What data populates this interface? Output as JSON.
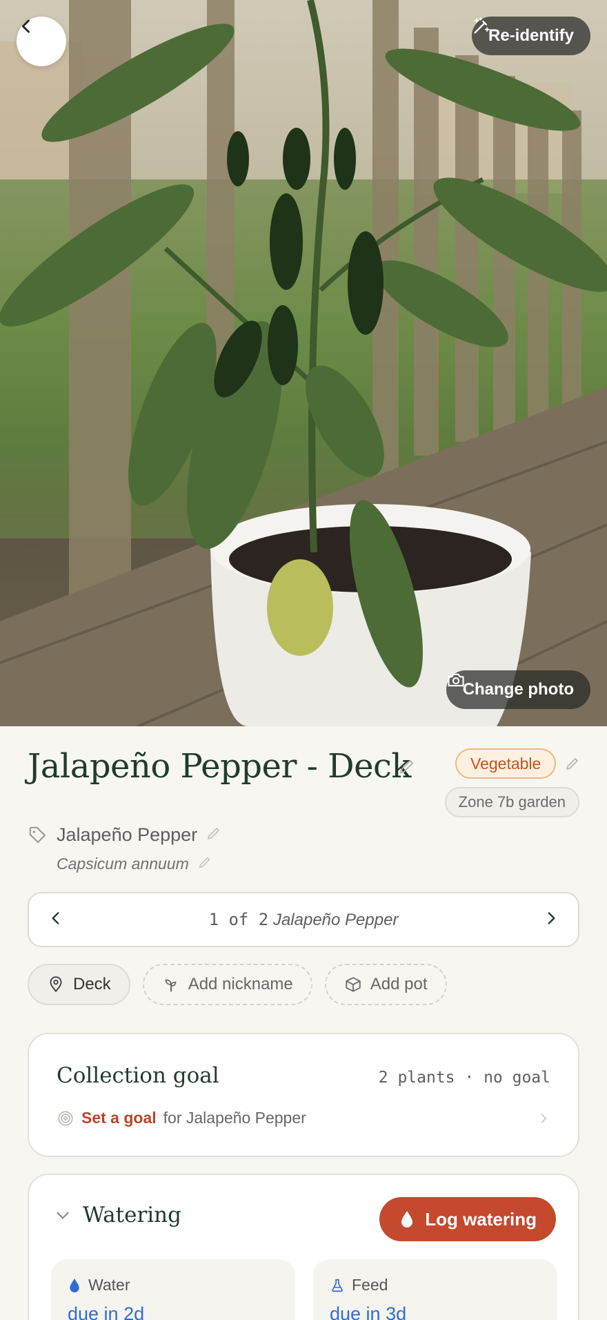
{
  "hero": {
    "reidentify_label": "Re-identify",
    "change_photo_label": "Change photo"
  },
  "plant": {
    "title": "Jalapeño Pepper - Deck",
    "category": "Vegetable",
    "zone": "Zone 7b garden",
    "species": "Jalapeño Pepper",
    "scientific": "Capsicum annuum"
  },
  "pager": {
    "position": "1 of 2",
    "name": "Jalapeño Pepper"
  },
  "chips": {
    "location": "Deck",
    "nickname": "Add nickname",
    "pot": "Add pot"
  },
  "goal": {
    "title": "Collection goal",
    "meta": "2 plants · no goal",
    "link": "Set a goal",
    "rest": "for Jalapeño Pepper"
  },
  "watering": {
    "title": "Watering",
    "log_label": "Log watering",
    "water_label": "Water",
    "water_value": "due in 2d",
    "feed_label": "Feed",
    "feed_value": "due in 3d"
  },
  "colors": {
    "accent": "#c5492c",
    "title_green": "#1f3b2d",
    "due_blue": "#2f6dd4",
    "badge_orange": "#c4541a"
  }
}
